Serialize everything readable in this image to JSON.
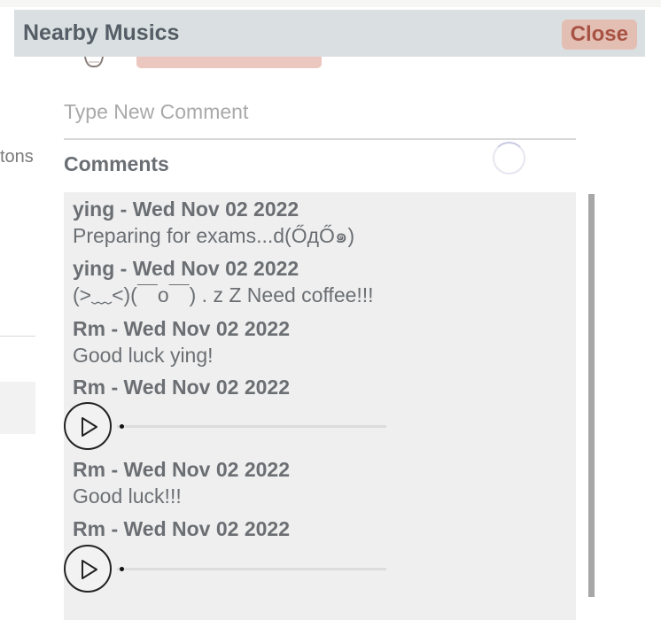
{
  "header": {
    "title": "Nearby Musics",
    "close_label": "Close"
  },
  "background": {
    "partial_text": "tons"
  },
  "comment_input": {
    "placeholder": "Type New Comment",
    "value": ""
  },
  "comments_label": "Comments",
  "comments": [
    {
      "author_line": "ying - Wed Nov 02 2022",
      "text": "Preparing for exams...d(ŐдŐ๑)",
      "type": "text"
    },
    {
      "author_line": "ying - Wed Nov 02 2022",
      "text": "(>﹏<)(￣o￣) . z Z Need coffee!!!",
      "type": "text"
    },
    {
      "author_line": "Rm - Wed Nov 02 2022",
      "text": "Good luck ying!",
      "type": "text"
    },
    {
      "author_line": "Rm - Wed Nov 02 2022",
      "type": "audio",
      "progress": 0
    },
    {
      "author_line": "Rm - Wed Nov 02 2022",
      "text": "Good luck!!!",
      "type": "text"
    },
    {
      "author_line": "Rm - Wed Nov 02 2022",
      "type": "audio",
      "progress": 0
    }
  ],
  "icons": {
    "play": "play-icon",
    "spinner": "loading-spinner-icon"
  },
  "colors": {
    "header_bg": "#dadfe1",
    "close_bg": "#e3bfb3",
    "close_text": "#a85244",
    "list_bg": "#efefef"
  }
}
